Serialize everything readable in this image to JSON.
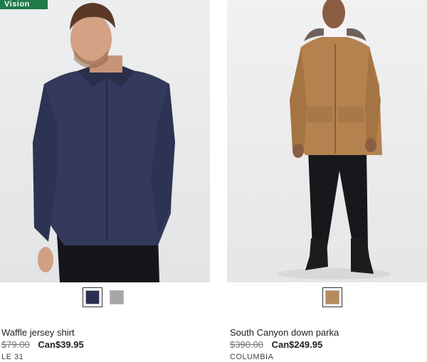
{
  "badge": {
    "label": "Vision"
  },
  "products": [
    {
      "name": "Waffle jersey shirt",
      "old_price": "$79.00",
      "new_price": "Can$39.95",
      "brand": "LE 31",
      "swatches": [
        {
          "color": "#2a2f4f",
          "selected": true
        },
        {
          "color": "#a7a7a7",
          "selected": false
        }
      ]
    },
    {
      "name": "South Canyon down parka",
      "old_price": "$390.00",
      "new_price": "Can$249.95",
      "brand": "COLUMBIA",
      "swatches": [
        {
          "color": "#b78a5c",
          "selected": true
        }
      ]
    }
  ]
}
